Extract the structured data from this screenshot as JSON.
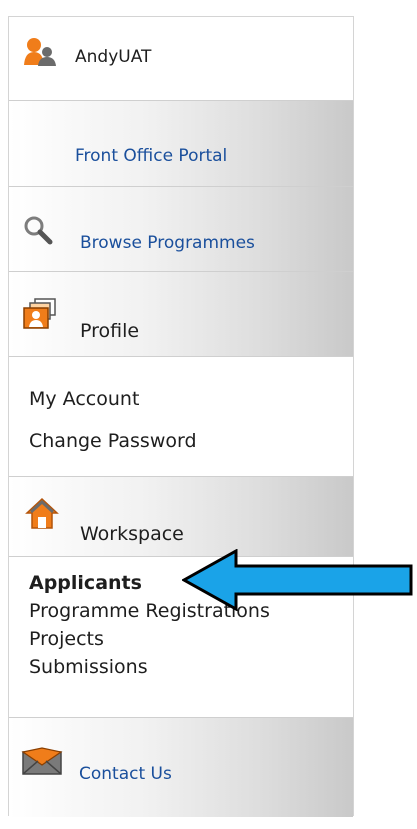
{
  "user": {
    "name": "AndyUAT",
    "icon": "user-group-icon"
  },
  "nav": {
    "front_office": "Front Office Portal",
    "browse": {
      "label": "Browse Programmes",
      "icon": "search-icon"
    },
    "profile": {
      "label": "Profile",
      "icon": "profile-cards-icon"
    },
    "account_links": [
      "My Account",
      "Change Password"
    ],
    "workspace": {
      "label": "Workspace",
      "icon": "home-icon"
    },
    "workspace_links": [
      "Applicants",
      "Programme Registrations",
      "Projects",
      "Submissions"
    ],
    "active_workspace_link": "Applicants",
    "contact": {
      "label": "Contact Us",
      "icon": "envelope-icon"
    }
  },
  "colors": {
    "link": "#1a4f9c",
    "arrow": "#1aa3e8",
    "icon_orange": "#f07d1a"
  },
  "annotation": {
    "arrow_icon": "left-arrow-icon",
    "points_to": "Applicants"
  }
}
